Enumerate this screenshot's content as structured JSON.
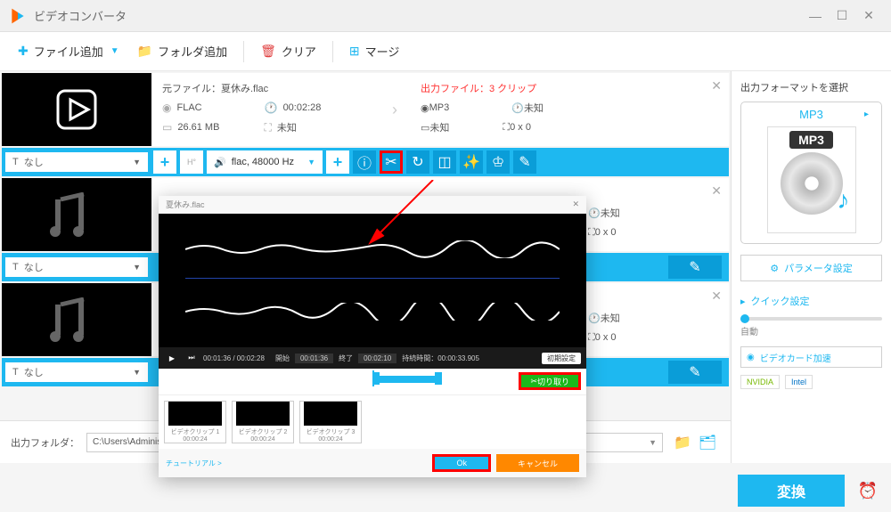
{
  "titlebar": {
    "title": "ビデオコンバータ"
  },
  "toolbar": {
    "add_file": "ファイル追加",
    "add_folder": "フォルダ追加",
    "clear": "クリア",
    "merge": "マージ"
  },
  "file1": {
    "source_label": "元ファイル：",
    "filename": "夏休み.flac",
    "format": "FLAC",
    "duration": "00:02:28",
    "size": "26.61 MB",
    "dim": "未知",
    "out_label": "出力ファイル：",
    "out_count": "3 クリップ",
    "out_format": "MP3",
    "out_duration": "未知",
    "out_size": "未知",
    "out_dim": "0 x 0"
  },
  "cyan": {
    "none": "なし",
    "audio_info": "flac, 48000 Hz"
  },
  "info2": {
    "duration": "未知",
    "dim": "0 x 0"
  },
  "info3": {
    "duration": "未知",
    "dim": "0 x 0"
  },
  "right": {
    "format_label": "出力フォーマットを選択",
    "format_name": "MP3",
    "format_badge": "MP3",
    "param": "パラメータ設定",
    "quick": "クイック設定",
    "auto": "自動",
    "gpu": "ビデオカード加速",
    "nvidia": "NVIDIA",
    "intel": "Intel"
  },
  "bottom": {
    "folder_label": "出力フォルダ：",
    "path": "C:\\Users\\Administrator\\Videos\\WonderFox Soft\\HD Video Converter Factory\\OutputVideo\\",
    "convert": "変換"
  },
  "modal": {
    "title": "夏休み.flac",
    "time_current": "00:01:36 / 00:02:28",
    "start_label": "開始",
    "start_time": "00:01:36",
    "end_label": "終了",
    "end_time": "00:02:10",
    "duration_label": "持続時間：",
    "duration": "00:00:33.905",
    "reset": "初期設定",
    "cut": "切り取り",
    "clip1": "ビデオクリップ 1",
    "clip1_time": "00:00:24",
    "clip2": "ビデオクリップ 2",
    "clip2_time": "00:00:24",
    "clip3": "ビデオクリップ 3",
    "clip3_time": "00:00:24",
    "tutorial": "チュートリアル >",
    "ok": "Ok",
    "cancel": "キャンセル"
  }
}
